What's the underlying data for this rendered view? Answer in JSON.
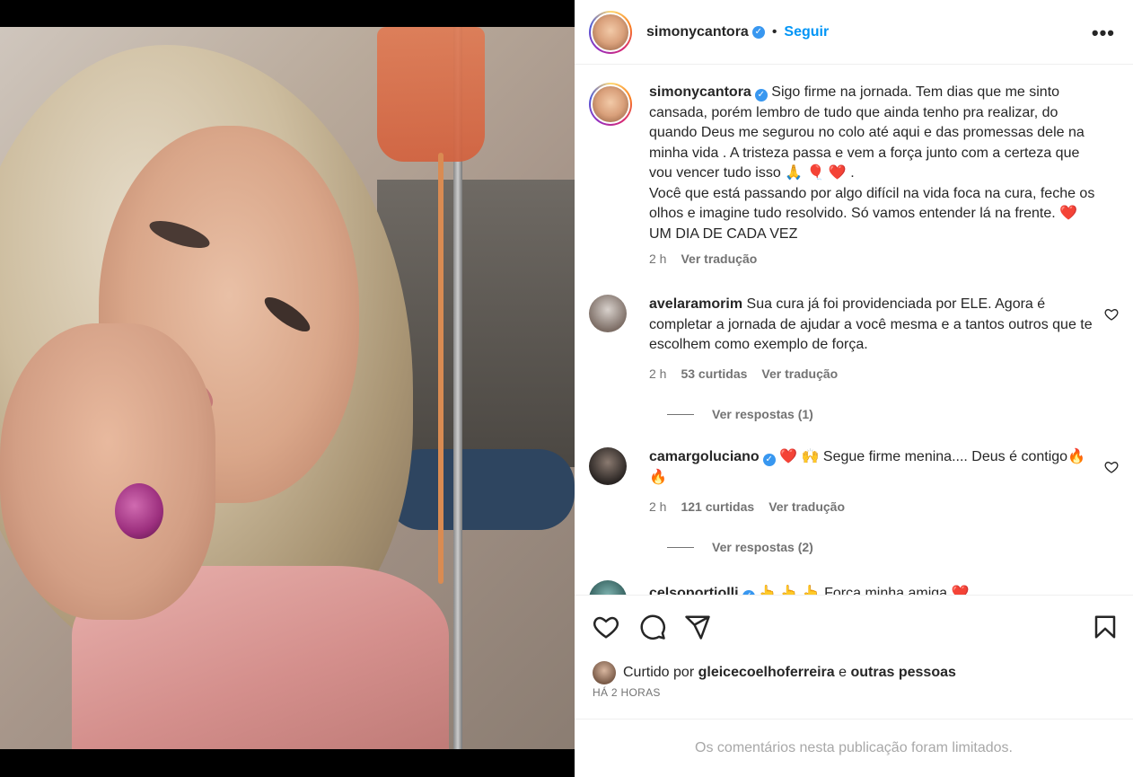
{
  "header": {
    "username": "simonycantora",
    "separator": "•",
    "follow_label": "Seguir",
    "more_label": "•••"
  },
  "caption": {
    "username": "simonycantora",
    "text": "Sigo firme na jornada. Tem dias que me sinto cansada, porém lembro de tudo que ainda tenho pra realizar, do quando Deus me segurou no colo até aqui e das promessas dele na minha vida . A tristeza passa e vem a força junto com a certeza que vou vencer tudo isso 🙏 🎈 ❤️ .",
    "text2": "Você que está passando por algo difícil na vida foca na cura, feche os olhos e imagine tudo resolvido. Só vamos entender lá na frente. ❤️ UM DIA DE CADA VEZ",
    "time": "2 h",
    "translate": "Ver tradução"
  },
  "comments": [
    {
      "username": "avelaramorim",
      "text": "Sua cura já foi providenciada por ELE. Agora é completar a jornada de ajudar a você mesma e a tantos outros que te escolhem como exemplo de força.",
      "time": "2 h",
      "likes": "53 curtidas",
      "translate": "Ver tradução",
      "replies": "Ver respostas (1)"
    },
    {
      "username": "camargoluciano",
      "text": "❤️ 🙌 Segue firme menina.... Deus é contigo🔥 🔥",
      "time": "2 h",
      "likes": "121 curtidas",
      "translate": "Ver tradução",
      "replies": "Ver respostas (2)"
    },
    {
      "username": "celsoportiolli",
      "text": "👆 👆 👆 Força minha amiga ❤️"
    }
  ],
  "liked_by": {
    "prefix": "Curtido por",
    "user": "gleicecoelhoferreira",
    "conj": "e",
    "others": "outras pessoas"
  },
  "timestamp": "HÁ 2 HORAS",
  "footer": "Os comentários nesta publicação foram limitados.",
  "colors": {
    "link": "#0095f6",
    "verified": "#3897f0",
    "like_red": "#ed4956"
  }
}
